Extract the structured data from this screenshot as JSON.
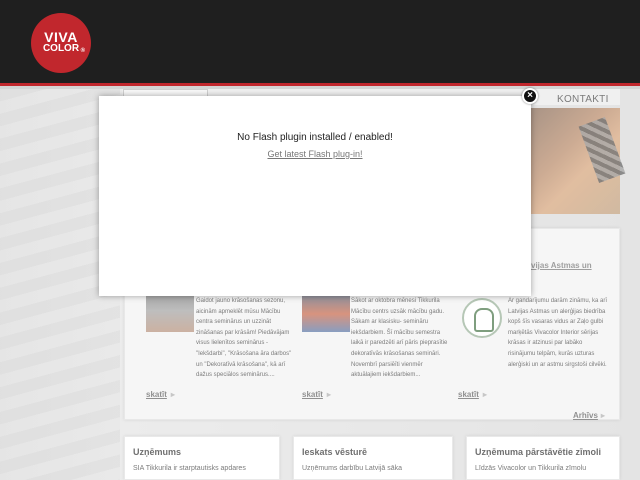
{
  "logo": {
    "line1": "VIVA",
    "line2": "COLOR",
    "mark": "®"
  },
  "nav": {
    "kontakti": "KONTAKTI"
  },
  "modal": {
    "message": "No Flash plugin installed / enabled!",
    "link": "Get latest Flash plug-in!",
    "close_icon": "×"
  },
  "news": {
    "title3": "Latvijas Astmas un",
    "items": [
      {
        "text": "Gaidot jauno krāsošanas sezonu, aicinām apmeklēt mūsu Mācību centra seminārus un uzzināt zināšanas par krāsām! Piedāvājam visus lielenītos seminārus - \"Iekšdarbi\", \"Krāsošana āra darbos\" un \"Dekoratīvā krāsošana\", kā arī dažus speciālos seminārus....",
        "link": "skatīt"
      },
      {
        "text": "Sākot ar oktobra mēnesi Tikkurila Mācību centrs uzsāk mācību gadu. Sākam ar klasisku- semināru iekšdarbiem. Šī mācību semestra laikā ir paredzēti arī pāris pieprasītie dekoratīvās krāsošanas semināri. Novembrī parsiēīti vienmēr aktuālajiem iekšdarbiem...",
        "link": "skatīt"
      },
      {
        "text": "Ar gandarījumu darām zināmu, ka arī Latvijas Astmas un alerģijas biedrība kopš šīs vasaras vidus ar Zaļo gulbi marķētās Vivacolor Interior sērijas krāsas ir atzinusi par labāko risinājumu telpām, kurās uzturas alerģiski un ar astmu sirgstoši cilvēki.",
        "link": "skatīt"
      }
    ],
    "archive": "Arhīvs"
  },
  "boxes": [
    {
      "title": "Uzņēmums",
      "text": "SIA Tikkurila ir starptautisks apdares"
    },
    {
      "title": "Ieskats vēsturē",
      "text": "Uzņēmums darbību Latvijā sāka"
    },
    {
      "title": "Uzņēmuma pārstāvētie zīmoli",
      "text": "Līdzās Vivacolor un Tikkurila zīmolu"
    }
  ]
}
